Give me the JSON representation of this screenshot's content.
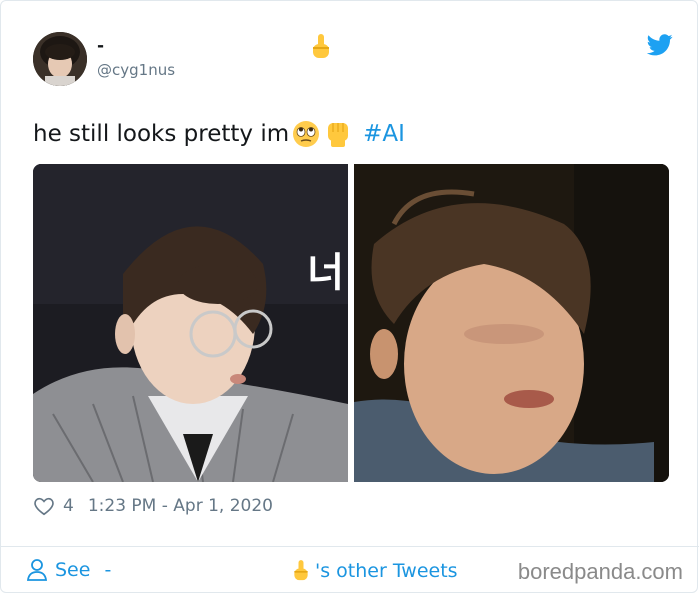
{
  "tweet": {
    "display_name": "-",
    "handle": "@cyg1nus",
    "text": "he still looks pretty im",
    "hashtag": "#AI",
    "likes": "4",
    "timestamp": "1:23 PM - Apr 1, 2020"
  },
  "footer": {
    "see_label": "See",
    "see_name": "-",
    "other_tweets_label": "'s other Tweets"
  },
  "watermark": "boredpanda.com",
  "photos": {
    "left_overlay_text": "너"
  },
  "colors": {
    "link": "#1b95e0",
    "secondary_text": "#657786",
    "primary_text": "#14171a",
    "border": "#e1e8ed"
  },
  "icons": [
    "twitter-bird-icon",
    "heart-icon",
    "person-icon",
    "pointing-finger-emoji",
    "rolling-eyes-emoji",
    "raised-fist-emoji"
  ]
}
